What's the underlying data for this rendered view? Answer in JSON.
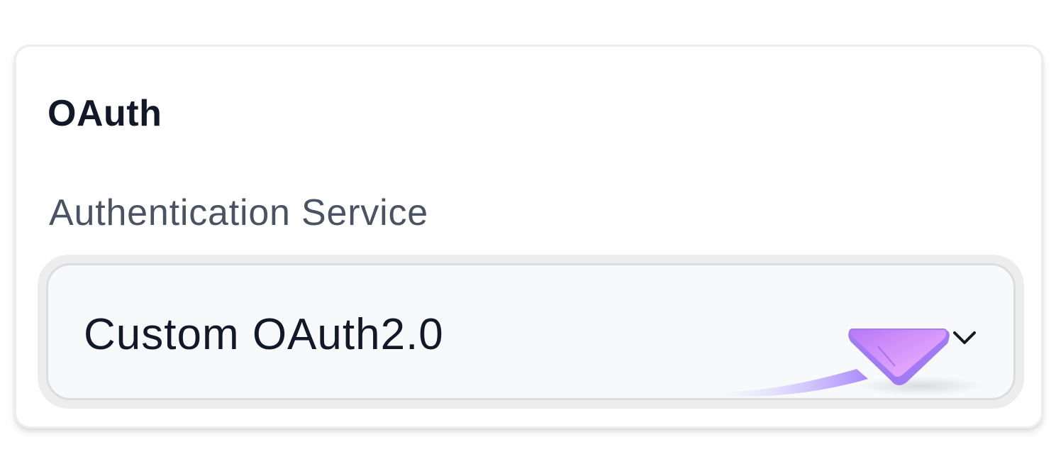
{
  "card": {
    "title": "OAuth",
    "field": {
      "label": "Authentication Service",
      "selected_value": "Custom OAuth2.0",
      "dropdown_icon": "chevron-down-icon"
    }
  },
  "overlay": {
    "cursor_icon": "pointer-cursor-icon",
    "cursor_color": "#b47cf5"
  }
}
